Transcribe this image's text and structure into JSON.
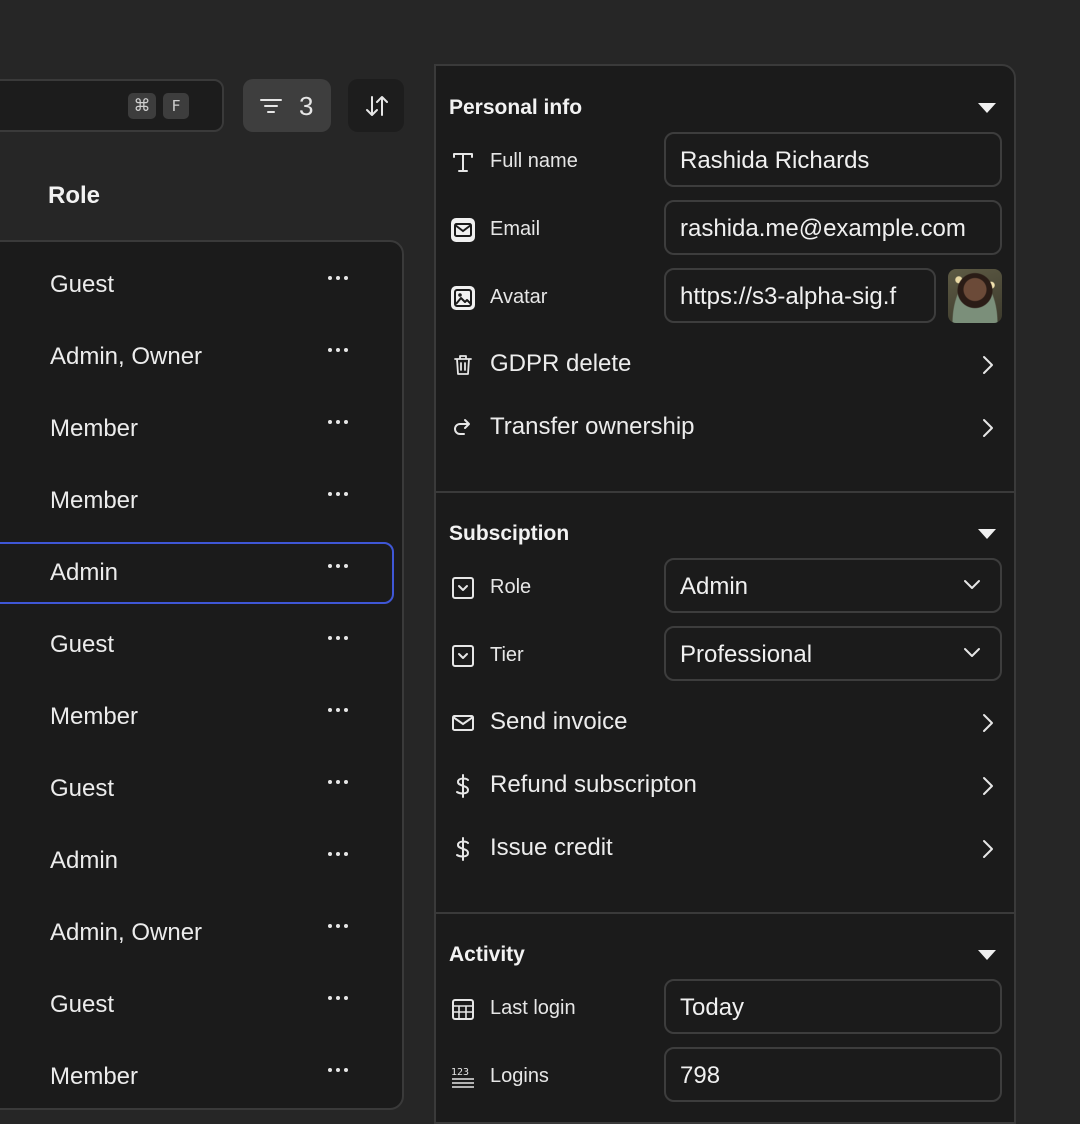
{
  "toolbar": {
    "shortcut_modifier": "⌘",
    "shortcut_key": "F",
    "filter_count": "3"
  },
  "table": {
    "column_header": "Role",
    "rows": [
      {
        "role": "Guest"
      },
      {
        "role": "Admin, Owner"
      },
      {
        "role": "Member"
      },
      {
        "role": "Member"
      },
      {
        "role": "Admin",
        "selected": true
      },
      {
        "role": "Guest"
      },
      {
        "role": "Member"
      },
      {
        "role": "Guest"
      },
      {
        "role": "Admin"
      },
      {
        "role": "Admin, Owner"
      },
      {
        "role": "Guest"
      },
      {
        "role": "Member"
      }
    ]
  },
  "panel": {
    "personal_info": {
      "title": "Personal info",
      "full_name_label": "Full name",
      "full_name_value": "Rashida Richards",
      "email_label": "Email",
      "email_value": "rashida.me@example.com",
      "avatar_label": "Avatar",
      "avatar_value": "https://s3-alpha-sig.f",
      "gdpr_label": "GDPR delete",
      "transfer_label": "Transfer ownership"
    },
    "subscription": {
      "title": "Subsciption",
      "role_label": "Role",
      "role_value": "Admin",
      "tier_label": "Tier",
      "tier_value": "Professional",
      "send_invoice_label": "Send invoice",
      "refund_label": "Refund subscripton",
      "issue_credit_label": "Issue credit"
    },
    "activity": {
      "title": "Activity",
      "last_login_label": "Last login",
      "last_login_value": "Today",
      "logins_label": "Logins",
      "logins_value": "798"
    }
  },
  "colors": {
    "background": "#262626",
    "surface": "#1b1b1b",
    "border": "#3a3a3a",
    "selection_accent": "#3f57d6",
    "text": "#ececec"
  }
}
